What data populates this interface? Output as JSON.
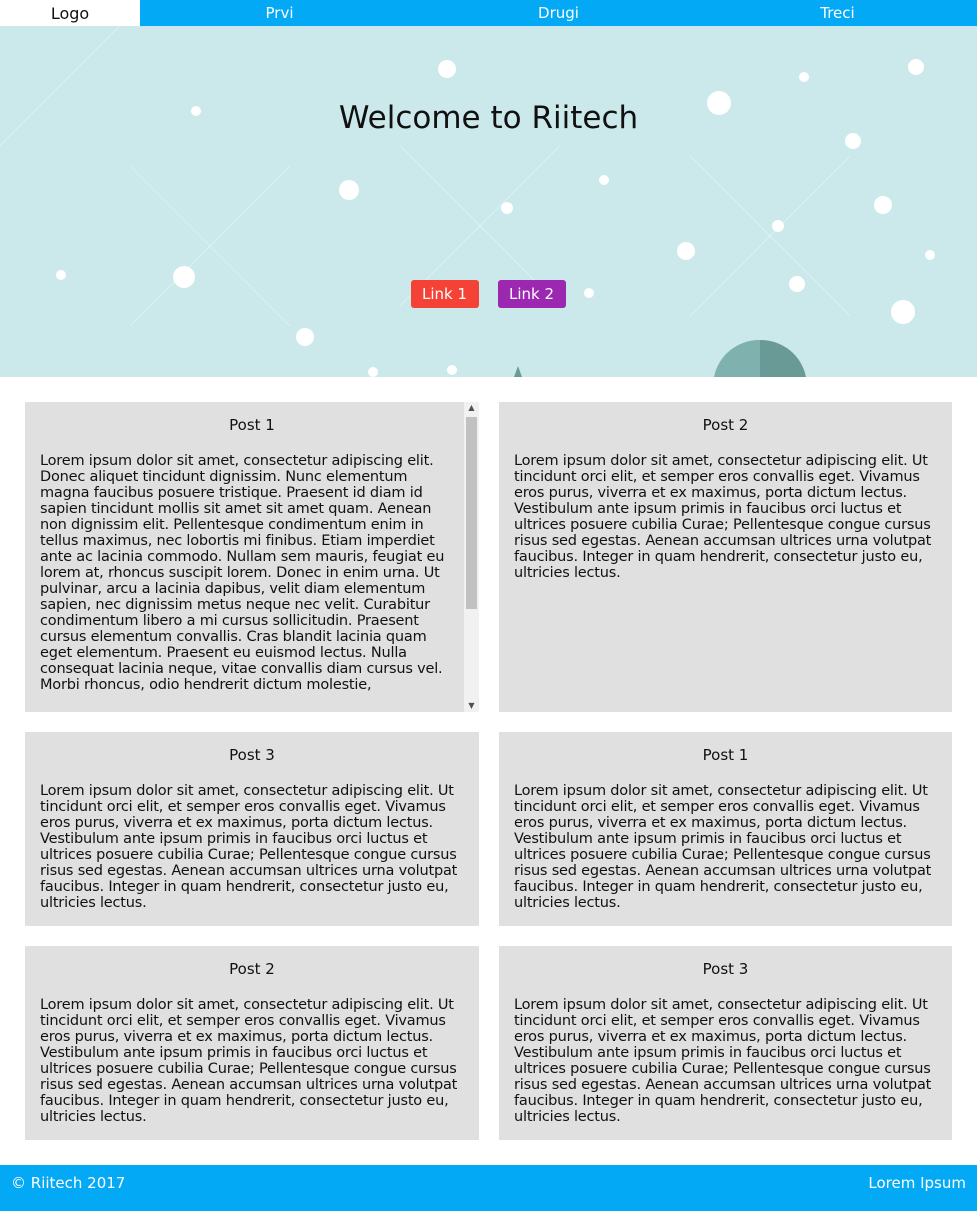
{
  "nav": {
    "logo": "Logo",
    "items": [
      "Prvi",
      "Drugi",
      "Treci"
    ]
  },
  "hero": {
    "title": "Welcome to Riitech",
    "link1": "Link 1",
    "link2": "Link 2",
    "colors": {
      "background": "#cbe9ea",
      "link1": "#f44336",
      "link2": "#9c27b0"
    }
  },
  "posts": [
    {
      "title": "Post 1",
      "body": "Lorem ipsum dolor sit amet, consectetur adipiscing elit. Donec aliquet tincidunt dignissim. Nunc elementum magna faucibus posuere tristique. Praesent id diam id sapien tincidunt mollis sit amet sit amet quam. Aenean non dignissim elit. Pellentesque condimentum enim in tellus maximus, nec lobortis mi finibus. Etiam imperdiet ante ac lacinia commodo. Nullam sem mauris, feugiat eu lorem at, rhoncus suscipit lorem. Donec in enim urna. Ut pulvinar, arcu a lacinia dapibus, velit diam elementum sapien, nec dignissim metus neque nec velit. Curabitur condimentum libero a mi cursus sollicitudin. Praesent cursus elementum convallis. Cras blandit lacinia quam eget elementum. Praesent eu euismod lectus. Nulla consequat lacinia neque, vitae convallis diam cursus vel. Morbi rhoncus, odio hendrerit dictum molestie,"
    },
    {
      "title": "Post 2",
      "body": "Lorem ipsum dolor sit amet, consectetur adipiscing elit. Ut tincidunt orci elit, et semper eros convallis eget. Vivamus eros purus, viverra et ex maximus, porta dictum lectus. Vestibulum ante ipsum primis in faucibus orci luctus et ultrices posuere cubilia Curae; Pellentesque congue cursus risus sed egestas. Aenean accumsan ultrices urna volutpat faucibus. Integer in quam hendrerit, consectetur justo eu, ultricies lectus."
    },
    {
      "title": "Post 3",
      "body": "Lorem ipsum dolor sit amet, consectetur adipiscing elit. Ut tincidunt orci elit, et semper eros convallis eget. Vivamus eros purus, viverra et ex maximus, porta dictum lectus. Vestibulum ante ipsum primis in faucibus orci luctus et ultrices posuere cubilia Curae; Pellentesque congue cursus risus sed egestas. Aenean accumsan ultrices urna volutpat faucibus. Integer in quam hendrerit, consectetur justo eu, ultricies lectus."
    },
    {
      "title": "Post 1",
      "body": "Lorem ipsum dolor sit amet, consectetur adipiscing elit. Ut tincidunt orci elit, et semper eros convallis eget. Vivamus eros purus, viverra et ex maximus, porta dictum lectus. Vestibulum ante ipsum primis in faucibus orci luctus et ultrices posuere cubilia Curae; Pellentesque congue cursus risus sed egestas. Aenean accumsan ultrices urna volutpat faucibus. Integer in quam hendrerit, consectetur justo eu, ultricies lectus."
    },
    {
      "title": "Post 2",
      "body": "Lorem ipsum dolor sit amet, consectetur adipiscing elit. Ut tincidunt orci elit, et semper eros convallis eget. Vivamus eros purus, viverra et ex maximus, porta dictum lectus. Vestibulum ante ipsum primis in faucibus orci luctus et ultrices posuere cubilia Curae; Pellentesque congue cursus risus sed egestas. Aenean accumsan ultrices urna volutpat faucibus. Integer in quam hendrerit, consectetur justo eu, ultricies lectus."
    },
    {
      "title": "Post 3",
      "body": "Lorem ipsum dolor sit amet, consectetur adipiscing elit. Ut tincidunt orci elit, et semper eros convallis eget. Vivamus eros purus, viverra et ex maximus, porta dictum lectus. Vestibulum ante ipsum primis in faucibus orci luctus et ultrices posuere cubilia Curae; Pellentesque congue cursus risus sed egestas. Aenean accumsan ultrices urna volutpat faucibus. Integer in quam hendrerit, consectetur justo eu, ultricies lectus."
    }
  ],
  "footer": {
    "copyright": "© Riitech 2017",
    "right": "Lorem Ipsum"
  },
  "theme": {
    "accent": "#03a9f4",
    "card": "#e0e0e0"
  }
}
